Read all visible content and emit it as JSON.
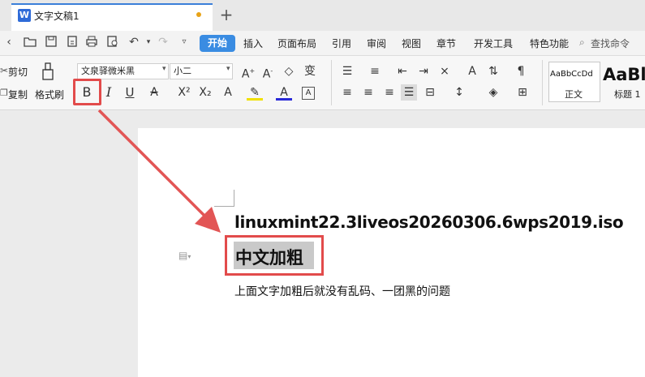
{
  "tab": {
    "title": "文字文稿1",
    "icon": "W",
    "add": "+"
  },
  "menu": {
    "start": "开始",
    "items": [
      "插入",
      "页面布局",
      "引用",
      "审阅",
      "视图",
      "章节",
      "开发工具",
      "特色功能"
    ],
    "search": "查找命令"
  },
  "ribbon": {
    "cut": "剪切",
    "copy": "复制",
    "format_painter": "格式刷",
    "font_name": "文泉驿微米黑",
    "font_size": "小二",
    "bold": "B",
    "italic": "I",
    "underline": "U",
    "style_normal_preview": "AaBbCcDd",
    "style_normal": "正文",
    "style_h1_preview": "AaBl",
    "style_h1": "标题 1"
  },
  "document": {
    "line1": "linuxmint22.3liveos20260306.6wps2019.iso",
    "line2": "中文加粗",
    "line3": "上面文字加粗后就没有乱码、一团黑的问题"
  },
  "colors": {
    "accent": "#3a8ce2",
    "annotation": "#e24b4b"
  }
}
